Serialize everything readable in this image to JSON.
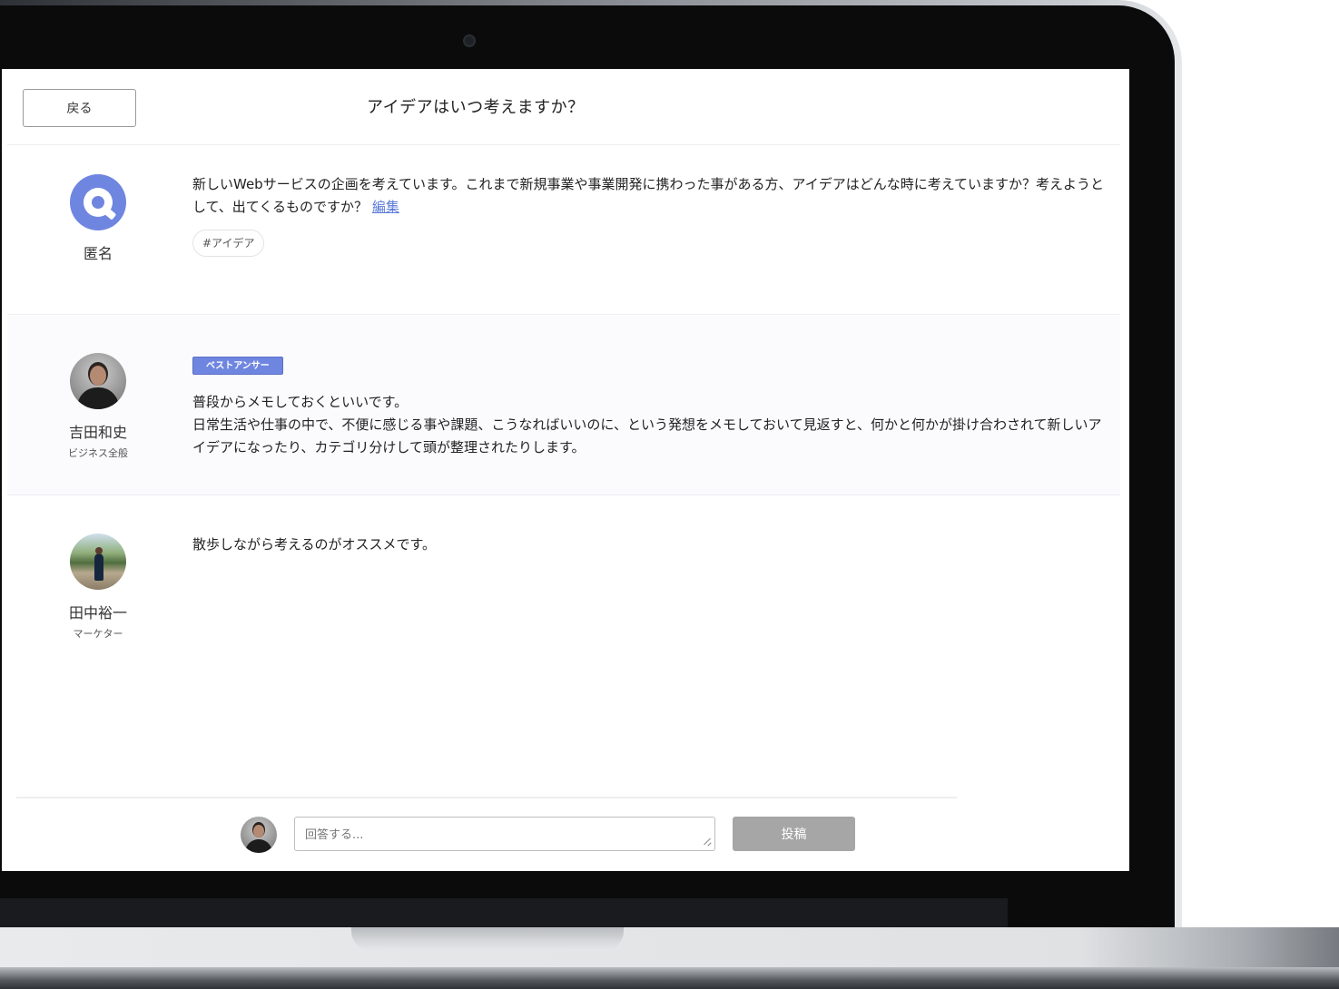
{
  "header": {
    "back_label": "戻る",
    "title": "アイデアはいつ考えますか？"
  },
  "question": {
    "author": {
      "name": "匿名",
      "avatar_icon": "anonymous-avatar-icon"
    },
    "body": "新しいWebサービスの企画を考えています。これまで新規事業や事業開発に携わった事がある方、アイデアはどんな時に考えていますか？考えようとして、出てくるものですか？",
    "edit_label": "編集",
    "tags": [
      "#アイデア"
    ]
  },
  "answers": [
    {
      "author": {
        "name": "吉田和史",
        "role": "ビジネス全般"
      },
      "badge": "ベストアンサー",
      "lines": [
        "普段からメモしておくといいです。",
        "日常生活や仕事の中で、不便に感じる事や課題、こうなればいいのに、という発想をメモしておいて見返すと、何かと何かが掛け合わされて新しいアイデアになったり、カテゴリ分けして頭が整理されたりします。"
      ]
    },
    {
      "author": {
        "name": "田中裕一",
        "role": "マーケター"
      },
      "lines": [
        "散歩しながら考えるのがオススメです。"
      ]
    }
  ],
  "composer": {
    "placeholder": "回答する...",
    "post_label": "投稿"
  },
  "colors": {
    "accent": "#6f86e0",
    "link": "#5b7ad8",
    "post_button_disabled": "#a6a6a6"
  }
}
